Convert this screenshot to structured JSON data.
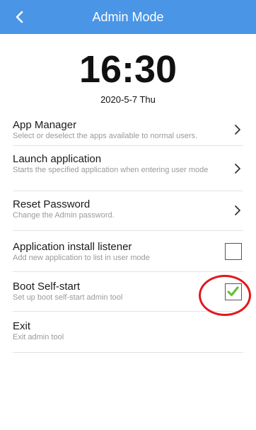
{
  "header": {
    "title": "Admin Mode",
    "back_icon": "chevron-left-icon",
    "color": "#4a95e6"
  },
  "clock": {
    "time": "16:30",
    "date": "2020-5-7 Thu"
  },
  "menu": {
    "items": [
      {
        "title": "App Manager",
        "description": "Select or deselect the apps available to normal users.",
        "control": "chevron"
      },
      {
        "title": "Launch application",
        "description": "Starts the specified application when entering user mode",
        "control": "chevron"
      },
      {
        "title": "Reset Password",
        "description": "Change the Admin password.",
        "control": "chevron"
      },
      {
        "title": "Application install listener",
        "description": "Add new application to list in user mode",
        "control": "checkbox",
        "checked": false
      },
      {
        "title": "Boot Self-start",
        "description": "Set up boot self-start admin tool",
        "control": "checkbox",
        "checked": true
      },
      {
        "title": "Exit",
        "description": "Exit admin tool",
        "control": "none"
      }
    ]
  },
  "colors": {
    "checkmark": "#5fbf34",
    "annotation": "#e0191b"
  }
}
